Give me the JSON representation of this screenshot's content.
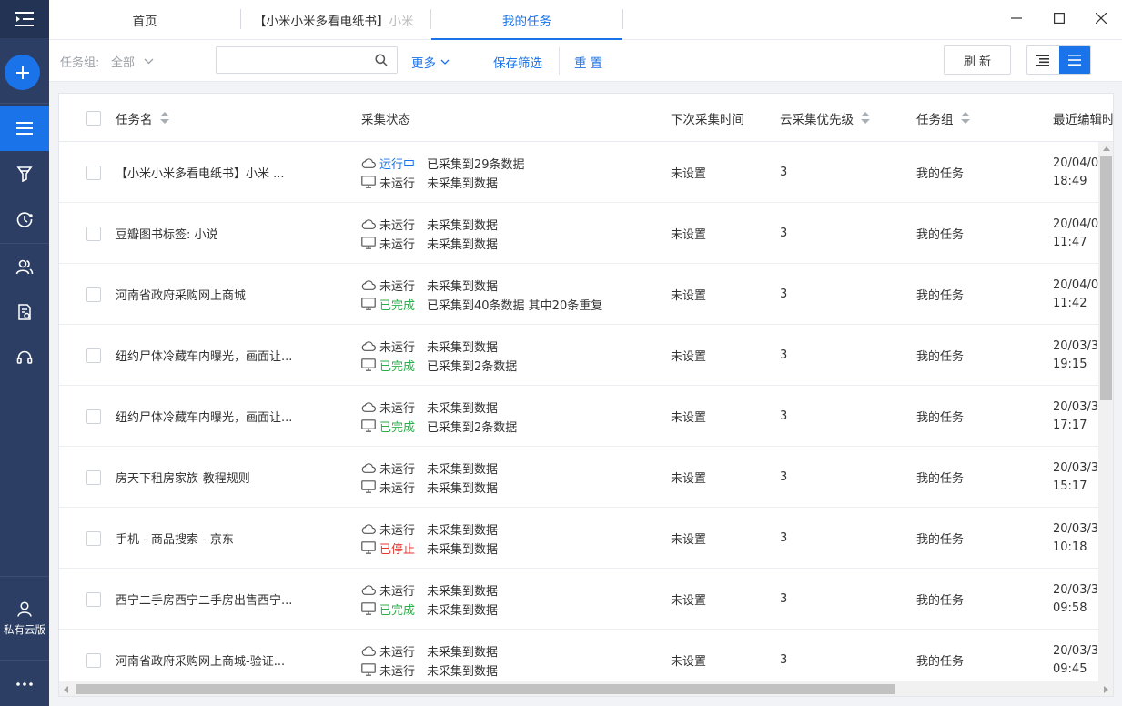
{
  "sidebar": {
    "private_label": "私有云版"
  },
  "tabs": [
    {
      "label": "首页"
    },
    {
      "label": "【小米小米多看电纸书】",
      "label_fade": "小米"
    },
    {
      "label": "我的任务"
    }
  ],
  "toolbar": {
    "group_label": "任务组:",
    "group_value": "全部",
    "search_placeholder": "",
    "more_label": "更多",
    "save_filter_label": "保存筛选",
    "reset_label": "重 置",
    "refresh_label": "刷 新"
  },
  "table": {
    "headers": {
      "name": "任务名",
      "status": "采集状态",
      "next_time": "下次采集时间",
      "priority": "云采集优先级",
      "group": "任务组",
      "last_edit": "最近编辑时"
    },
    "rows": [
      {
        "name": "【小米小米多看电纸书】小米 ...",
        "cloud_status": "运行中",
        "cloud_status_type": "running",
        "cloud_detail": "已采集到29条数据",
        "local_status": "未运行",
        "local_status_type": "idle",
        "local_detail": "未采集到数据",
        "next_time": "未设置",
        "priority": "3",
        "group": "我的任务",
        "date": "20/04/0",
        "time": "18:49"
      },
      {
        "name": "豆瓣图书标签: 小说",
        "cloud_status": "未运行",
        "cloud_status_type": "idle",
        "cloud_detail": "未采集到数据",
        "local_status": "未运行",
        "local_status_type": "idle",
        "local_detail": "未采集到数据",
        "next_time": "未设置",
        "priority": "3",
        "group": "我的任务",
        "date": "20/04/0",
        "time": "11:47"
      },
      {
        "name": "河南省政府采购网上商城",
        "cloud_status": "未运行",
        "cloud_status_type": "idle",
        "cloud_detail": "未采集到数据",
        "local_status": "已完成",
        "local_status_type": "done",
        "local_detail": "已采集到40条数据 其中20条重复",
        "next_time": "未设置",
        "priority": "3",
        "group": "我的任务",
        "date": "20/04/0",
        "time": "11:42"
      },
      {
        "name": "纽约尸体冷藏车内曝光，画面让...",
        "cloud_status": "未运行",
        "cloud_status_type": "idle",
        "cloud_detail": "未采集到数据",
        "local_status": "已完成",
        "local_status_type": "done",
        "local_detail": "已采集到2条数据",
        "next_time": "未设置",
        "priority": "3",
        "group": "我的任务",
        "date": "20/03/3",
        "time": "19:15"
      },
      {
        "name": "纽约尸体冷藏车内曝光，画面让...",
        "cloud_status": "未运行",
        "cloud_status_type": "idle",
        "cloud_detail": "未采集到数据",
        "local_status": "已完成",
        "local_status_type": "done",
        "local_detail": "已采集到2条数据",
        "next_time": "未设置",
        "priority": "3",
        "group": "我的任务",
        "date": "20/03/3",
        "time": "17:17"
      },
      {
        "name": "房天下租房家族-教程规则",
        "cloud_status": "未运行",
        "cloud_status_type": "idle",
        "cloud_detail": "未采集到数据",
        "local_status": "未运行",
        "local_status_type": "idle",
        "local_detail": "未采集到数据",
        "next_time": "未设置",
        "priority": "3",
        "group": "我的任务",
        "date": "20/03/3",
        "time": "15:17"
      },
      {
        "name": "手机 - 商品搜索 - 京东",
        "cloud_status": "未运行",
        "cloud_status_type": "idle",
        "cloud_detail": "未采集到数据",
        "local_status": "已停止",
        "local_status_type": "stopped",
        "local_detail": "未采集到数据",
        "next_time": "未设置",
        "priority": "3",
        "group": "我的任务",
        "date": "20/03/3",
        "time": "10:18"
      },
      {
        "name": "西宁二手房西宁二手房出售西宁...",
        "cloud_status": "未运行",
        "cloud_status_type": "idle",
        "cloud_detail": "未采集到数据",
        "local_status": "已完成",
        "local_status_type": "done",
        "local_detail": "未采集到数据",
        "next_time": "未设置",
        "priority": "3",
        "group": "我的任务",
        "date": "20/03/3",
        "time": "09:58"
      },
      {
        "name": "河南省政府采购网上商城-验证...",
        "cloud_status": "未运行",
        "cloud_status_type": "idle",
        "cloud_detail": "未采集到数据",
        "local_status": "未运行",
        "local_status_type": "idle",
        "local_detail": "未采集到数据",
        "next_time": "未设置",
        "priority": "3",
        "group": "我的任务",
        "date": "20/03/3",
        "time": "09:45"
      }
    ]
  },
  "colors": {
    "accent": "#1a73e8",
    "sidebar_bg": "#2c3e63",
    "done": "#2dae4d",
    "stopped": "#e53935"
  }
}
